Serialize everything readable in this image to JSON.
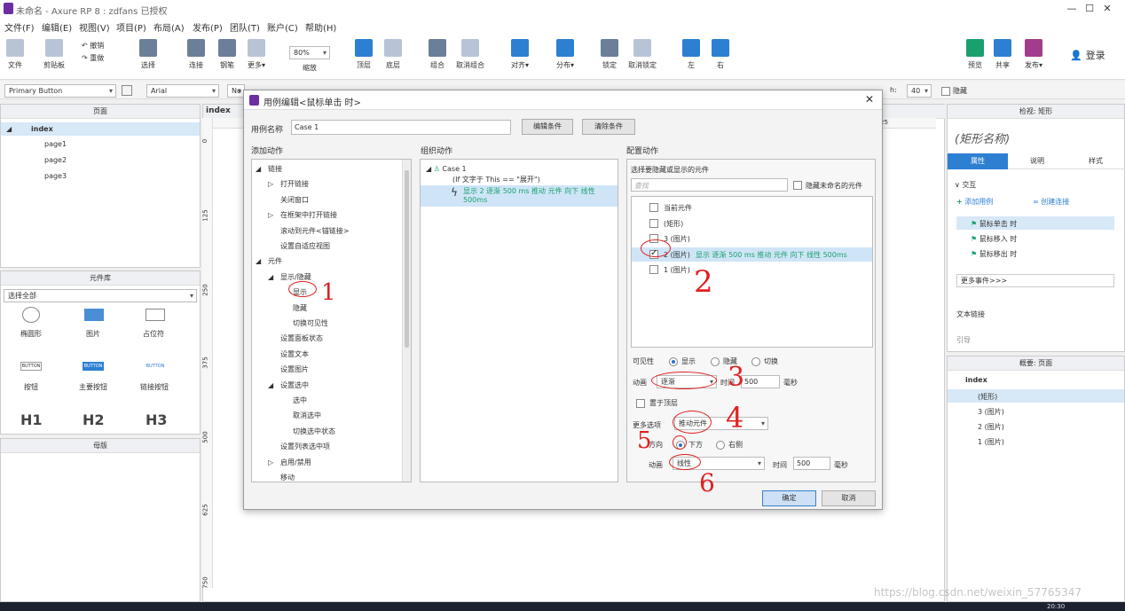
{
  "window": {
    "title": "未命名 - Axure RP 8 : zdfans 已授权",
    "min": "—",
    "max": "☐",
    "close": "✕"
  },
  "menu": [
    "文件(F)",
    "编辑(E)",
    "视图(V)",
    "项目(P)",
    "布局(A)",
    "发布(P)",
    "团队(T)",
    "账户(C)",
    "帮助(H)"
  ],
  "toolbar": {
    "file": "文件",
    "clipboard": "剪贴板",
    "undo": "撤销",
    "redo": "重做",
    "select": "选择",
    "connect": "连接",
    "pen": "钢笔",
    "more": "更多▾",
    "zoom_value": "80%",
    "zoom": "缩放",
    "top": "顶层",
    "bottom": "底层",
    "group": "组合",
    "ungroup": "取消组合",
    "align": "对齐▾",
    "distribute": "分布▾",
    "lock": "锁定",
    "unlock": "取消锁定",
    "left": "左",
    "right": "右",
    "preview": "预览",
    "share": "共享",
    "publish": "发布▾",
    "login": "登录"
  },
  "format": {
    "style": "Primary Button",
    "font": "Arial",
    "font_style": "No",
    "h_label": "h:",
    "h_value": "40",
    "hidden": "隐藏"
  },
  "pages_panel": {
    "title": "页面",
    "root": "index",
    "pages": [
      "page1",
      "page2",
      "page3"
    ]
  },
  "library_panel": {
    "title": "元件库",
    "filter": "选择全部",
    "items": [
      "椭圆形",
      "图片",
      "占位符",
      "按钮",
      "主要按钮",
      "链接按钮",
      "H1",
      "H2",
      "H3"
    ],
    "button_samples": [
      "BUTTON",
      "BUTTON",
      "BUTTON"
    ]
  },
  "masters_panel": {
    "title": "母版"
  },
  "canvas": {
    "tab": "index",
    "ruler_v": [
      "0",
      "125",
      "250",
      "375",
      "500",
      "625",
      "750"
    ],
    "ruler_h_mark": "25"
  },
  "inspector": {
    "title": "检视: 矩形",
    "shape_name": "(矩形名称)",
    "tabs": [
      "属性",
      "说明",
      "样式"
    ],
    "section": "交互",
    "add_case": "添加用例",
    "create_link": "创建连接",
    "events": [
      "鼠标单击 时",
      "鼠标移入 时",
      "鼠标移出 时"
    ],
    "more_events": "更多事件>>>",
    "text_link": "文本链接",
    "cut": "引导"
  },
  "outline": {
    "title": "概要: 页面",
    "root": "index",
    "items": [
      "(矩形)",
      "3 (图片)",
      "2 (图片)",
      "1 (图片)"
    ]
  },
  "dialog": {
    "title": "用例编辑<鼠标单击 时>",
    "case_label": "用例名称",
    "case_name": "Case 1",
    "edit_cond": "编辑条件",
    "clear_cond": "清除条件",
    "col1": "添加动作",
    "col2": "组织动作",
    "col3": "配置动作",
    "actions": [
      {
        "t": "链接",
        "lvl": 0,
        "arrow": "◢"
      },
      {
        "t": "打开链接",
        "lvl": 1,
        "arrow": "▷"
      },
      {
        "t": "关闭窗口",
        "lvl": 1,
        "arrow": ""
      },
      {
        "t": "在框架中打开链接",
        "lvl": 1,
        "arrow": "▷"
      },
      {
        "t": "滚动到元件<锚链接>",
        "lvl": 1,
        "arrow": ""
      },
      {
        "t": "设置自适应视图",
        "lvl": 1,
        "arrow": ""
      },
      {
        "t": "元件",
        "lvl": 0,
        "arrow": "◢"
      },
      {
        "t": "显示/隐藏",
        "lvl": 1,
        "arrow": "◢"
      },
      {
        "t": "显示",
        "lvl": 2,
        "arrow": ""
      },
      {
        "t": "隐藏",
        "lvl": 2,
        "arrow": ""
      },
      {
        "t": "切换可见性",
        "lvl": 2,
        "arrow": ""
      },
      {
        "t": "设置面板状态",
        "lvl": 1,
        "arrow": ""
      },
      {
        "t": "设置文本",
        "lvl": 1,
        "arrow": ""
      },
      {
        "t": "设置图片",
        "lvl": 1,
        "arrow": ""
      },
      {
        "t": "设置选中",
        "lvl": 1,
        "arrow": "◢"
      },
      {
        "t": "选中",
        "lvl": 2,
        "arrow": ""
      },
      {
        "t": "取消选中",
        "lvl": 2,
        "arrow": ""
      },
      {
        "t": "切换选中状态",
        "lvl": 2,
        "arrow": ""
      },
      {
        "t": "设置列表选中项",
        "lvl": 1,
        "arrow": ""
      },
      {
        "t": "启用/禁用",
        "lvl": 1,
        "arrow": "▷"
      },
      {
        "t": "移动",
        "lvl": 1,
        "arrow": ""
      }
    ],
    "org": {
      "case": "Case 1",
      "cond": "(If 文字于 This == \"展开\")",
      "action": "显示 2 逐渐 500 ms 推动 元件 向下 线性 500ms"
    },
    "cfg_heading": "选择要隐藏或显示的元件",
    "search_placeholder": "查找",
    "hide_unnamed": "隐藏未命名的元件",
    "targets": [
      {
        "t": "当前元件",
        "checked": false,
        "extra": ""
      },
      {
        "t": "(矩形)",
        "checked": false,
        "extra": ""
      },
      {
        "t": "3 (图片)",
        "checked": false,
        "extra": ""
      },
      {
        "t": "2 (图片)",
        "checked": true,
        "extra": "显示 逐渐 500 ms 推动 元件 向下 线性 500ms"
      },
      {
        "t": "1 (图片)",
        "checked": false,
        "extra": ""
      }
    ],
    "visibility": "可见性",
    "vis_show": "显示",
    "vis_hide": "隐藏",
    "vis_toggle": "切换",
    "anim": "动画",
    "anim_value": "逐渐",
    "time": "时间",
    "time_value": "500",
    "ms": "毫秒",
    "bring_top": "置于顶层",
    "more_opts": "更多选项",
    "more_value": "推动元件",
    "direction": "方向",
    "dir_down": "下方",
    "dir_right": "右侧",
    "anim2": "动画",
    "anim2_value": "线性",
    "time2": "时间",
    "time2_value": "500",
    "ms2": "毫秒",
    "ok": "确定",
    "cancel": "取消"
  },
  "annotations": [
    "1",
    "2",
    "3",
    "4",
    "5",
    "6"
  ],
  "watermark": "https://blog.csdn.net/weixin_57765347",
  "clock": "20:30"
}
